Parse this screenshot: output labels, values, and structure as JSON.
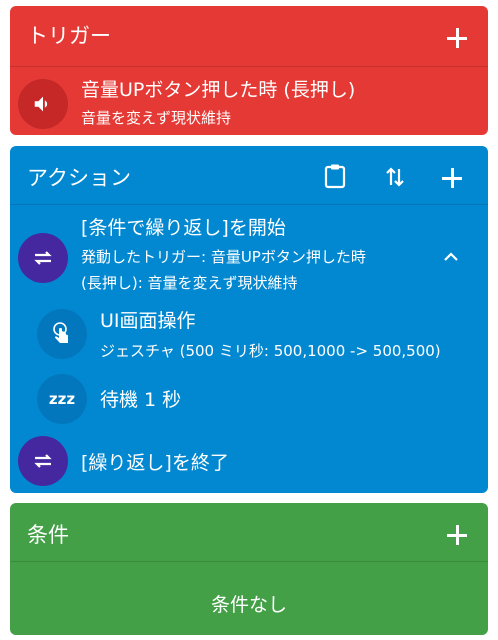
{
  "trigger": {
    "title": "トリガー",
    "item": {
      "title": "音量UPボタン押した時 (長押し)",
      "subtitle": "音量を変えず現状維持",
      "icon": "volume-icon"
    }
  },
  "action": {
    "title": "アクション",
    "items": [
      {
        "title": "[条件で繰り返し]を開始",
        "line1": "発動したトリガー: 音量UPボタン押した時",
        "line2": "(長押し): 音量を変えず現状維持",
        "icon": "repeat-icon"
      },
      {
        "title": "UI画面操作",
        "subtitle": "ジェスチャ (500 ミリ秒: 500,1000 -> 500,500)",
        "icon": "touch-icon"
      },
      {
        "title": "待機 1 秒",
        "icon": "sleep-icon",
        "icon_text": "zzz"
      },
      {
        "title": "[繰り返し]を終了",
        "icon": "repeat-icon"
      }
    ]
  },
  "conditions": {
    "title": "条件",
    "empty": "条件なし"
  },
  "colors": {
    "trigger": "#e53935",
    "trigger_icon_bg": "#c62828",
    "action": "#0288d1",
    "action_icon_bg": "#0277bd",
    "loop_icon_bg": "#4527a0",
    "conditions": "#43a047"
  }
}
